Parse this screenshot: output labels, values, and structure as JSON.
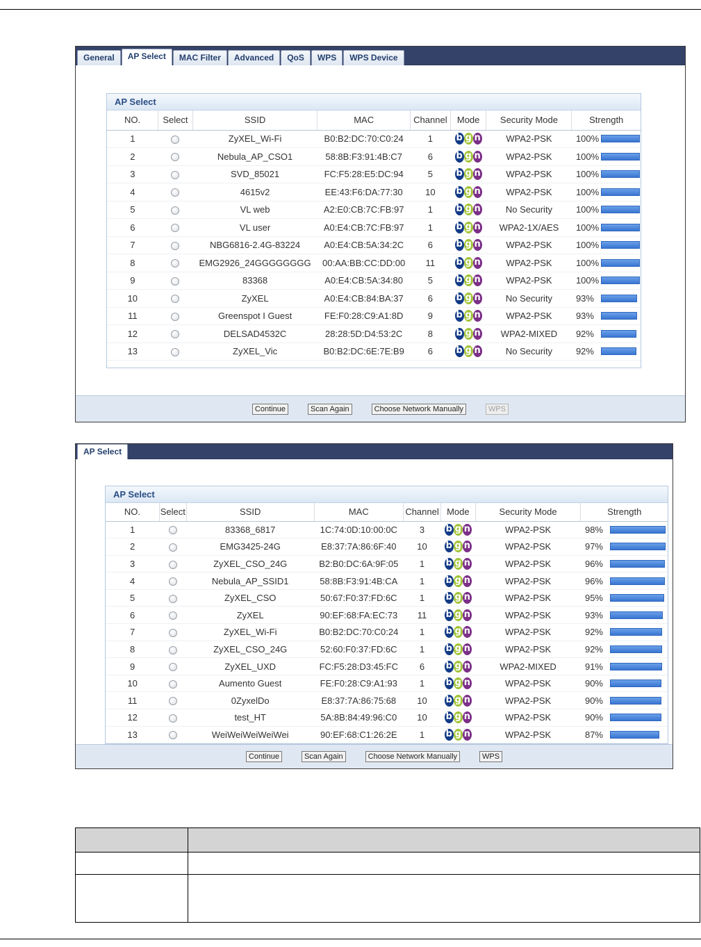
{
  "screen1": {
    "tabs": [
      "General",
      "AP Select",
      "MAC Filter",
      "Advanced",
      "QoS",
      "WPS",
      "WPS Device"
    ],
    "active_tab": "AP Select",
    "group_title": "AP Select",
    "columns": [
      "NO.",
      "Select",
      "SSID",
      "MAC",
      "Channel",
      "Mode",
      "Security Mode",
      "Strength"
    ],
    "rows": [
      {
        "no": "1",
        "ssid": "ZyXEL_Wi-Fi",
        "mac": "B0:B2:DC:70:C0:24",
        "channel": "1",
        "security": "WPA2-PSK",
        "strength": "100%",
        "level": 100
      },
      {
        "no": "2",
        "ssid": "Nebula_AP_CSO1",
        "mac": "58:8B:F3:91:4B:C7",
        "channel": "6",
        "security": "WPA2-PSK",
        "strength": "100%",
        "level": 100
      },
      {
        "no": "3",
        "ssid": "SVD_85021",
        "mac": "FC:F5:28:E5:DC:94",
        "channel": "5",
        "security": "WPA2-PSK",
        "strength": "100%",
        "level": 100
      },
      {
        "no": "4",
        "ssid": "4615v2",
        "mac": "EE:43:F6:DA:77:30",
        "channel": "10",
        "security": "WPA2-PSK",
        "strength": "100%",
        "level": 100
      },
      {
        "no": "5",
        "ssid": "VL web",
        "mac": "A2:E0:CB:7C:FB:97",
        "channel": "1",
        "security": "No Security",
        "strength": "100%",
        "level": 100
      },
      {
        "no": "6",
        "ssid": "VL user",
        "mac": "A0:E4:CB:7C:FB:97",
        "channel": "1",
        "security": "WPA2-1X/AES",
        "strength": "100%",
        "level": 100
      },
      {
        "no": "7",
        "ssid": "NBG6816-2.4G-83224",
        "mac": "A0:E4:CB:5A:34:2C",
        "channel": "6",
        "security": "WPA2-PSK",
        "strength": "100%",
        "level": 100
      },
      {
        "no": "8",
        "ssid": "EMG2926_24GGGGGGGG",
        "mac": "00:AA:BB:CC:DD:00",
        "channel": "11",
        "security": "WPA2-PSK",
        "strength": "100%",
        "level": 100
      },
      {
        "no": "9",
        "ssid": "83368",
        "mac": "A0:E4:CB:5A:34:80",
        "channel": "5",
        "security": "WPA2-PSK",
        "strength": "100%",
        "level": 100
      },
      {
        "no": "10",
        "ssid": "ZyXEL",
        "mac": "A0:E4:CB:84:BA:37",
        "channel": "6",
        "security": "No Security",
        "strength": "93%",
        "level": 93
      },
      {
        "no": "11",
        "ssid": "Greenspot I Guest",
        "mac": "FE:F0:28:C9:A1:8D",
        "channel": "9",
        "security": "WPA2-PSK",
        "strength": "93%",
        "level": 93
      },
      {
        "no": "12",
        "ssid": "DELSAD4532C",
        "mac": "28:28:5D:D4:53:2C",
        "channel": "8",
        "security": "WPA2-MIXED",
        "strength": "92%",
        "level": 92
      },
      {
        "no": "13",
        "ssid": "ZyXEL_Vic",
        "mac": "B0:B2:DC:6E:7E:B9",
        "channel": "6",
        "security": "No Security",
        "strength": "92%",
        "level": 92
      }
    ],
    "buttons": {
      "continue": "Continue",
      "scan_again": "Scan Again",
      "choose_manually": "Choose Network Manually",
      "wps": "WPS"
    }
  },
  "screen2": {
    "tabs": [
      "AP Select"
    ],
    "active_tab": "AP Select",
    "group_title": "AP Select",
    "columns": [
      "NO.",
      "Select",
      "SSID",
      "MAC",
      "Channel",
      "Mode",
      "Security Mode",
      "Strength"
    ],
    "rows": [
      {
        "no": "1",
        "ssid": "83368_6817",
        "mac": "1C:74:0D:10:00:0C",
        "channel": "3",
        "security": "WPA2-PSK",
        "strength": "98%",
        "level": 98
      },
      {
        "no": "2",
        "ssid": "EMG3425-24G",
        "mac": "E8:37:7A:86:6F:40",
        "channel": "10",
        "security": "WPA2-PSK",
        "strength": "97%",
        "level": 97
      },
      {
        "no": "3",
        "ssid": "ZyXEL_CSO_24G",
        "mac": "B2:B0:DC:6A:9F:05",
        "channel": "1",
        "security": "WPA2-PSK",
        "strength": "96%",
        "level": 96
      },
      {
        "no": "4",
        "ssid": "Nebula_AP_SSID1",
        "mac": "58:8B:F3:91:4B:CA",
        "channel": "1",
        "security": "WPA2-PSK",
        "strength": "96%",
        "level": 96
      },
      {
        "no": "5",
        "ssid": "ZyXEL_CSO",
        "mac": "50:67:F0:37:FD:6C",
        "channel": "1",
        "security": "WPA2-PSK",
        "strength": "95%",
        "level": 95
      },
      {
        "no": "6",
        "ssid": "ZyXEL",
        "mac": "90:EF:68:FA:EC:73",
        "channel": "11",
        "security": "WPA2-PSK",
        "strength": "93%",
        "level": 93
      },
      {
        "no": "7",
        "ssid": "ZyXEL_Wi-Fi",
        "mac": "B0:B2:DC:70:C0:24",
        "channel": "1",
        "security": "WPA2-PSK",
        "strength": "92%",
        "level": 92
      },
      {
        "no": "8",
        "ssid": "ZyXEL_CSO_24G",
        "mac": "52:60:F0:37:FD:6C",
        "channel": "1",
        "security": "WPA2-PSK",
        "strength": "92%",
        "level": 92
      },
      {
        "no": "9",
        "ssid": "ZyXEL_UXD",
        "mac": "FC:F5:28:D3:45:FC",
        "channel": "6",
        "security": "WPA2-MIXED",
        "strength": "91%",
        "level": 91
      },
      {
        "no": "10",
        "ssid": "Aumento Guest",
        "mac": "FE:F0:28:C9:A1:93",
        "channel": "1",
        "security": "WPA2-PSK",
        "strength": "90%",
        "level": 90
      },
      {
        "no": "11",
        "ssid": "0ZyxelDo",
        "mac": "E8:37:7A:86:75:68",
        "channel": "10",
        "security": "WPA2-PSK",
        "strength": "90%",
        "level": 90
      },
      {
        "no": "12",
        "ssid": "test_HT",
        "mac": "5A:8B:84:49:96:C0",
        "channel": "10",
        "security": "WPA2-PSK",
        "strength": "90%",
        "level": 90
      },
      {
        "no": "13",
        "ssid": "WeiWeiWeiWeiWei",
        "mac": "90:EF:68:C1:26:2E",
        "channel": "1",
        "security": "WPA2-PSK",
        "strength": "87%",
        "level": 87
      }
    ],
    "buttons": {
      "continue": "Continue",
      "scan_again": "Scan Again",
      "choose_manually": "Choose Network Manually",
      "wps": "WPS"
    }
  },
  "mode_letters": [
    "b",
    "g",
    "n"
  ],
  "colors": {
    "tabbar": "#34426a",
    "mode_b": "#123a86",
    "mode_g": "#a2c439",
    "mode_n": "#7b2f87",
    "strength_bar": "#3a76d2"
  }
}
